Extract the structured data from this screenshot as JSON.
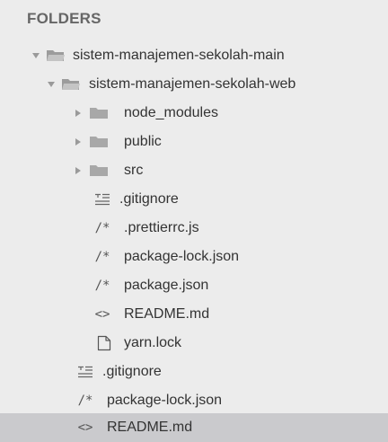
{
  "sidebar": {
    "header": "FOLDERS",
    "items": [
      {
        "label": "sistem-manajemen-sekolah-main"
      },
      {
        "label": "sistem-manajemen-sekolah-web"
      },
      {
        "label": "node_modules"
      },
      {
        "label": "public"
      },
      {
        "label": "src"
      },
      {
        "label": ".gitignore"
      },
      {
        "label": ".prettierrc.js"
      },
      {
        "label": "package-lock.json"
      },
      {
        "label": "package.json"
      },
      {
        "label": "README.md"
      },
      {
        "label": "yarn.lock"
      },
      {
        "label": ".gitignore"
      },
      {
        "label": "package-lock.json"
      },
      {
        "label": "README.md"
      }
    ],
    "icons": {
      "comment": "/*",
      "code": "<>"
    }
  }
}
